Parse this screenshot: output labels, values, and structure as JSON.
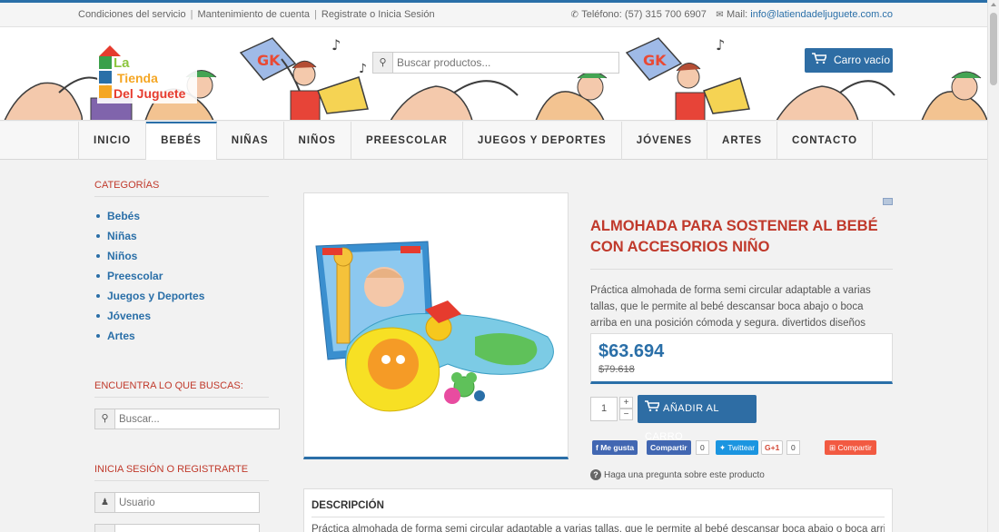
{
  "topbar": {
    "links": [
      "Condiciones del servicio",
      "Mantenimiento de cuenta",
      "Registrate o Inicia Sesión"
    ],
    "phone_label": "Teléfono: (57) 315 700 6907",
    "mail_label": "Mail:",
    "mail_value": "info@latiendadeljuguete.com.co"
  },
  "header": {
    "logo_text": "La Tienda Del Juguete",
    "search_placeholder": "Buscar productos...",
    "cart_label": "Carro vacío"
  },
  "nav": {
    "items": [
      "INICIO",
      "BEBÉS",
      "NIÑAS",
      "NIÑOS",
      "PREESCOLAR",
      "JUEGOS Y DEPORTES",
      "JÓVENES",
      "ARTES",
      "CONTACTO"
    ],
    "active": "BEBÉS"
  },
  "sidebar": {
    "categories_title": "CATEGORÍAS",
    "categories": [
      "Bebés",
      "Niñas",
      "Niños",
      "Preescolar",
      "Juegos y Deportes",
      "Jóvenes",
      "Artes"
    ],
    "search_title": "ENCUENTRA LO QUE BUSCAS:",
    "search_placeholder": "Buscar...",
    "login_title": "INICIA SESIÓN O REGISTRARTE",
    "username_placeholder": "Usuario"
  },
  "product": {
    "title": "ALMOHADA PARA SOSTENER AL BEBÉ CON ACCESORIOS NIÑO",
    "description": "Práctica almohada de forma semi circular adaptable a varias tallas, que le permite al bebé descansar boca abajo o boca arriba en una posición cómoda y segura. divertidos diseños",
    "price": "$63.694",
    "old_price": "$79.618",
    "quantity": "1",
    "add_to_cart": "AÑADIR AL CARRO",
    "ask_question": "Haga una pregunta sobre este producto"
  },
  "social": {
    "fb_like": "Me gusta",
    "fb_share": "Compartir",
    "fb_count": "0",
    "tweet": "Twittear",
    "gplus": "G+1",
    "gplus_count": "0",
    "share": "Compartir"
  },
  "description_section": {
    "title": "DESCRIPCIÓN",
    "text": "Práctica almohada de forma semi circular adaptable a varias tallas, que le permite al bebé descansar boca abajo o boca arriba en"
  },
  "colors": {
    "accent": "#2a6fa8",
    "title_red": "#c0392b"
  }
}
